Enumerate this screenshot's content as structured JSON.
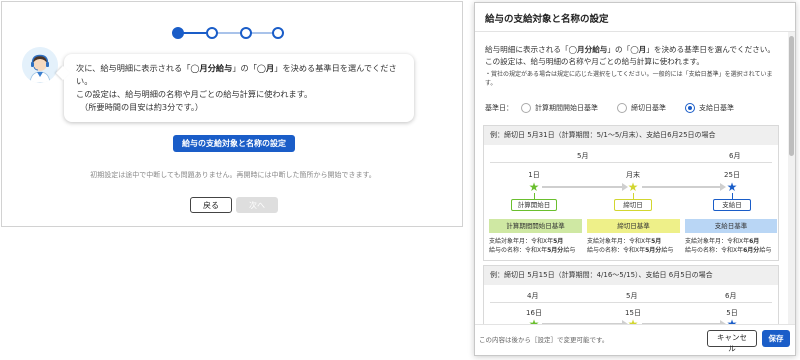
{
  "wizard": {
    "message": {
      "line1_prefix": "次に、給与明細に表示される「",
      "line1_bold1": "◯月分給与",
      "line1_mid": "」の「",
      "line1_bold2": "◯月",
      "line1_suffix": "」を決める基準日を選んでください。",
      "line2": "この設定は、給与明細の名称や月ごとの給与計算に使われます。",
      "line3": "（所要時間の目安は約3分です。）"
    },
    "primary_button": "給与の支給対象と名称の設定",
    "note": "初期設定は途中で中断しても問題ありません。再開時には中断した箇所から開始できます。",
    "back_button": "戻る",
    "next_button": "次へ",
    "steps_total": 4,
    "steps_active": 1
  },
  "modal": {
    "title": "給与の支給対象と名称の設定",
    "desc_prefix": "給与明細に表示される「",
    "desc_bold1": "◯月分給与",
    "desc_mid": "」の「",
    "desc_bold2": "◯月",
    "desc_suffix": "」を決める基準日を選んでください。",
    "desc_line2": "この設定は、給与明細の名称や月ごとの給与計算に使われます。",
    "subnote": "・賞社の規定がある場合は規定に応じた選択をしてください。一般的には「支給日基準」を選択されています。",
    "basis_label": "基準日：",
    "options": [
      "計算期間開始日基準",
      "締切日基準",
      "支給日基準"
    ],
    "selected_option": "支給日基準",
    "example1": {
      "heading": "例：締切日 5月31日（計算期間：5/1〜5/月末）、支給日6月25日の場合",
      "months": [
        "5月",
        "6月"
      ],
      "days": [
        "1日",
        "月末",
        "25日"
      ],
      "tags": [
        "計算開始日",
        "締切日",
        "支給日"
      ],
      "bands": [
        "計算期間開始日基準",
        "締切日基準",
        "支給日基準"
      ],
      "details": [
        {
          "line1_prefix": "支給対象年月：令和X年",
          "line1_bold": "5月",
          "line2_prefix": "給与の名称：令和X年",
          "line2_bold": "5月分",
          "line2_suffix": "給与"
        },
        {
          "line1_prefix": "支給対象年月：令和X年",
          "line1_bold": "5月",
          "line2_prefix": "給与の名称：令和X年",
          "line2_bold": "5月分",
          "line2_suffix": "給与"
        },
        {
          "line1_prefix": "支給対象年月：令和X年",
          "line1_bold": "6月",
          "line2_prefix": "給与の名称：令和X年",
          "line2_bold": "6月分",
          "line2_suffix": "給与"
        }
      ]
    },
    "example2": {
      "heading": "例：締切日 5月15日（計算期間：4/16〜5/15）、支給日 6月5日の場合",
      "months": [
        "4月",
        "5月",
        "6月"
      ],
      "days": [
        "16日",
        "15日",
        "5日"
      ]
    },
    "footer_note": "この内容は後から［設定］で変更可能です。",
    "cancel_button": "キャンセル",
    "save_button": "保存"
  },
  "colors": {
    "primary": "#1a5dc8",
    "green": "#6abf2e",
    "yellow": "#d2d630",
    "blue": "#1a5dc8",
    "band_green": "#cfe8a3",
    "band_yellow": "#eef089",
    "band_blue": "#b9d6f5"
  }
}
